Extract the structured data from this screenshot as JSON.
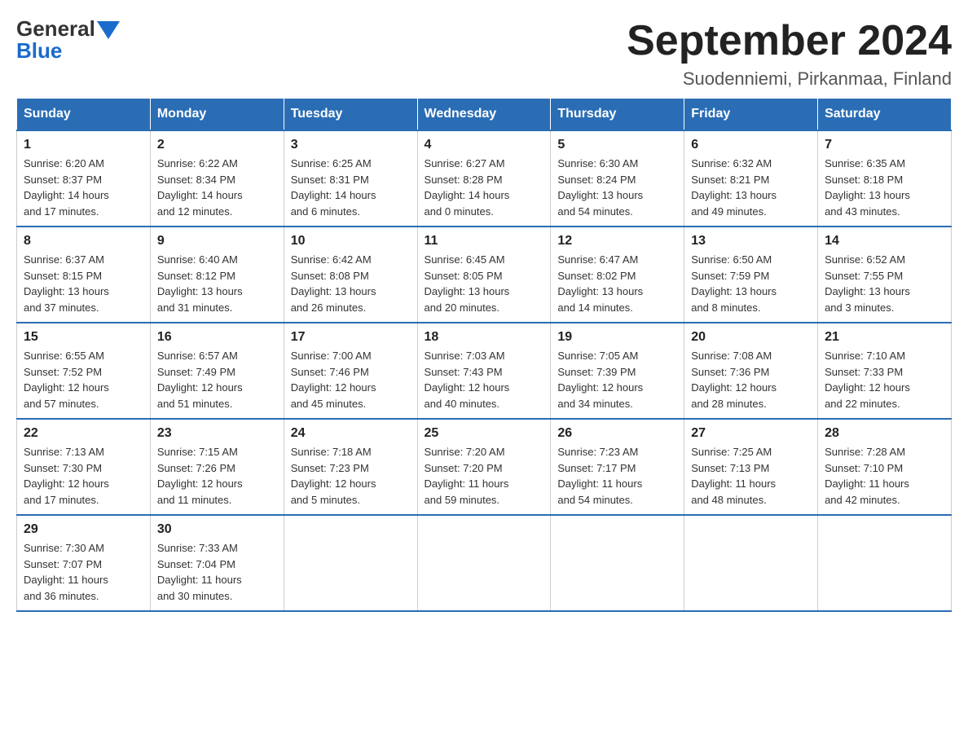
{
  "header": {
    "logo_general": "General",
    "logo_blue": "Blue",
    "title": "September 2024",
    "subtitle": "Suodenniemi, Pirkanmaa, Finland"
  },
  "days_of_week": [
    "Sunday",
    "Monday",
    "Tuesday",
    "Wednesday",
    "Thursday",
    "Friday",
    "Saturday"
  ],
  "weeks": [
    [
      {
        "day": "1",
        "sunrise": "6:20 AM",
        "sunset": "8:37 PM",
        "daylight": "14 hours and 17 minutes."
      },
      {
        "day": "2",
        "sunrise": "6:22 AM",
        "sunset": "8:34 PM",
        "daylight": "14 hours and 12 minutes."
      },
      {
        "day": "3",
        "sunrise": "6:25 AM",
        "sunset": "8:31 PM",
        "daylight": "14 hours and 6 minutes."
      },
      {
        "day": "4",
        "sunrise": "6:27 AM",
        "sunset": "8:28 PM",
        "daylight": "14 hours and 0 minutes."
      },
      {
        "day": "5",
        "sunrise": "6:30 AM",
        "sunset": "8:24 PM",
        "daylight": "13 hours and 54 minutes."
      },
      {
        "day": "6",
        "sunrise": "6:32 AM",
        "sunset": "8:21 PM",
        "daylight": "13 hours and 49 minutes."
      },
      {
        "day": "7",
        "sunrise": "6:35 AM",
        "sunset": "8:18 PM",
        "daylight": "13 hours and 43 minutes."
      }
    ],
    [
      {
        "day": "8",
        "sunrise": "6:37 AM",
        "sunset": "8:15 PM",
        "daylight": "13 hours and 37 minutes."
      },
      {
        "day": "9",
        "sunrise": "6:40 AM",
        "sunset": "8:12 PM",
        "daylight": "13 hours and 31 minutes."
      },
      {
        "day": "10",
        "sunrise": "6:42 AM",
        "sunset": "8:08 PM",
        "daylight": "13 hours and 26 minutes."
      },
      {
        "day": "11",
        "sunrise": "6:45 AM",
        "sunset": "8:05 PM",
        "daylight": "13 hours and 20 minutes."
      },
      {
        "day": "12",
        "sunrise": "6:47 AM",
        "sunset": "8:02 PM",
        "daylight": "13 hours and 14 minutes."
      },
      {
        "day": "13",
        "sunrise": "6:50 AM",
        "sunset": "7:59 PM",
        "daylight": "13 hours and 8 minutes."
      },
      {
        "day": "14",
        "sunrise": "6:52 AM",
        "sunset": "7:55 PM",
        "daylight": "13 hours and 3 minutes."
      }
    ],
    [
      {
        "day": "15",
        "sunrise": "6:55 AM",
        "sunset": "7:52 PM",
        "daylight": "12 hours and 57 minutes."
      },
      {
        "day": "16",
        "sunrise": "6:57 AM",
        "sunset": "7:49 PM",
        "daylight": "12 hours and 51 minutes."
      },
      {
        "day": "17",
        "sunrise": "7:00 AM",
        "sunset": "7:46 PM",
        "daylight": "12 hours and 45 minutes."
      },
      {
        "day": "18",
        "sunrise": "7:03 AM",
        "sunset": "7:43 PM",
        "daylight": "12 hours and 40 minutes."
      },
      {
        "day": "19",
        "sunrise": "7:05 AM",
        "sunset": "7:39 PM",
        "daylight": "12 hours and 34 minutes."
      },
      {
        "day": "20",
        "sunrise": "7:08 AM",
        "sunset": "7:36 PM",
        "daylight": "12 hours and 28 minutes."
      },
      {
        "day": "21",
        "sunrise": "7:10 AM",
        "sunset": "7:33 PM",
        "daylight": "12 hours and 22 minutes."
      }
    ],
    [
      {
        "day": "22",
        "sunrise": "7:13 AM",
        "sunset": "7:30 PM",
        "daylight": "12 hours and 17 minutes."
      },
      {
        "day": "23",
        "sunrise": "7:15 AM",
        "sunset": "7:26 PM",
        "daylight": "12 hours and 11 minutes."
      },
      {
        "day": "24",
        "sunrise": "7:18 AM",
        "sunset": "7:23 PM",
        "daylight": "12 hours and 5 minutes."
      },
      {
        "day": "25",
        "sunrise": "7:20 AM",
        "sunset": "7:20 PM",
        "daylight": "11 hours and 59 minutes."
      },
      {
        "day": "26",
        "sunrise": "7:23 AM",
        "sunset": "7:17 PM",
        "daylight": "11 hours and 54 minutes."
      },
      {
        "day": "27",
        "sunrise": "7:25 AM",
        "sunset": "7:13 PM",
        "daylight": "11 hours and 48 minutes."
      },
      {
        "day": "28",
        "sunrise": "7:28 AM",
        "sunset": "7:10 PM",
        "daylight": "11 hours and 42 minutes."
      }
    ],
    [
      {
        "day": "29",
        "sunrise": "7:30 AM",
        "sunset": "7:07 PM",
        "daylight": "11 hours and 36 minutes."
      },
      {
        "day": "30",
        "sunrise": "7:33 AM",
        "sunset": "7:04 PM",
        "daylight": "11 hours and 30 minutes."
      },
      null,
      null,
      null,
      null,
      null
    ]
  ]
}
